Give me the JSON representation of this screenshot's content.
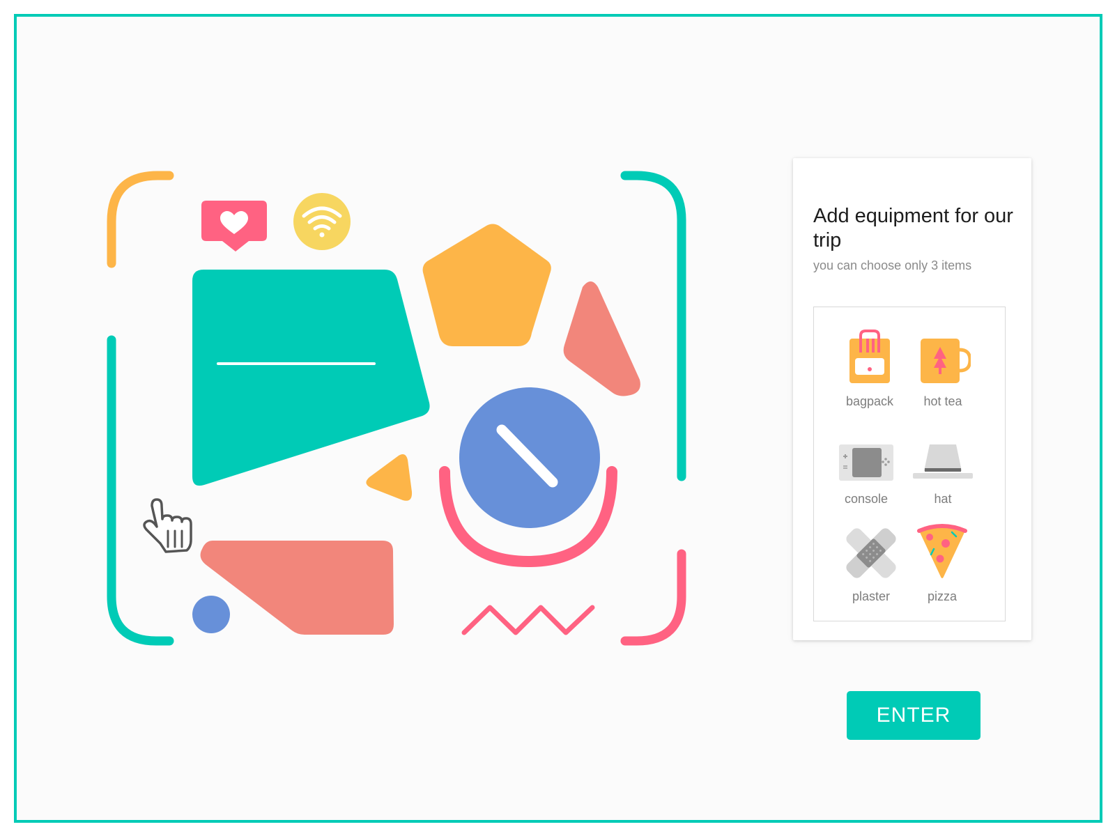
{
  "app": {
    "accent_color": "#00cbb6"
  },
  "card": {
    "title": "Add equipment for our trip",
    "subtitle": "you can choose only 3 items"
  },
  "items": [
    {
      "label": "bagpack",
      "icon": "backpack-icon"
    },
    {
      "label": "hot tea",
      "icon": "tea-mug-icon"
    },
    {
      "label": "console",
      "icon": "game-console-icon"
    },
    {
      "label": "hat",
      "icon": "hat-icon"
    },
    {
      "label": "plaster",
      "icon": "plaster-icon"
    },
    {
      "label": "pizza",
      "icon": "pizza-slice-icon"
    }
  ],
  "enter_button": {
    "label": "ENTER"
  },
  "illustration": {
    "colors": {
      "teal": "#00cbb6",
      "orange": "#fdb548",
      "coral": "#f2867b",
      "pink": "#ff6282",
      "blue": "#6790d9",
      "yellow": "#f7d660"
    },
    "icons": [
      "heart-chat-icon",
      "wifi-icon",
      "pointer-hand-icon",
      "blocked-sign-icon",
      "zigzag-icon"
    ]
  }
}
